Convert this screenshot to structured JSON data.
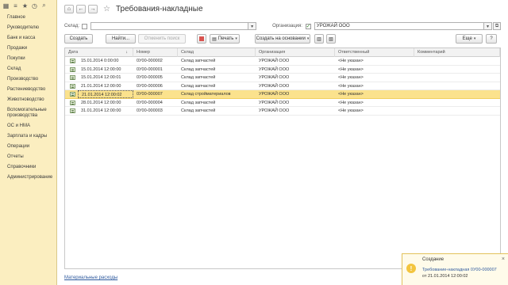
{
  "sidebar": {
    "top_icons": [
      "apps-grid-icon",
      "menu-icon",
      "star-icon",
      "history-icon",
      "search-icon"
    ],
    "items": [
      {
        "label": "Главное"
      },
      {
        "label": "Руководителю"
      },
      {
        "label": "Банк и касса"
      },
      {
        "label": "Продажи"
      },
      {
        "label": "Покупки"
      },
      {
        "label": "Склад"
      },
      {
        "label": "Производство"
      },
      {
        "label": "Растениеводство"
      },
      {
        "label": "Животноводство"
      },
      {
        "label": "Вспомогательные производства"
      },
      {
        "label": "ОС и НМА"
      },
      {
        "label": "Зарплата и кадры"
      },
      {
        "label": "Операции"
      },
      {
        "label": "Отчеты"
      },
      {
        "label": "Справочники"
      },
      {
        "label": "Администрирование"
      }
    ]
  },
  "header": {
    "title": "Требования-накладные",
    "home_glyph": "⌂",
    "back_glyph": "←",
    "forward_glyph": "→",
    "star_glyph": "☆"
  },
  "filters": {
    "warehouse_label": "Склад:",
    "warehouse_value": "",
    "organization_label": "Организация:",
    "organization_value": "УРОЖАЙ ООО",
    "dropdown_glyph": "▾",
    "open_glyph": "⧉",
    "check_glyph": "✓"
  },
  "toolbar": {
    "create": "Создать",
    "find": "Найти...",
    "cancel_search": "Отменить поиск",
    "print": "Печать",
    "create_based": "Создать на основании",
    "more": "Еще",
    "help": "?",
    "dropdown_glyph": "▾"
  },
  "table": {
    "columns": [
      "Дата",
      "Номер",
      "Склад",
      "Организация",
      "Ответственный",
      "Комментарий"
    ],
    "sort_glyph": "↓",
    "rows": [
      {
        "date": "15.01.2014 0:00:00",
        "number": "0У00-000002",
        "warehouse": "Склад запчастей",
        "org": "УРОЖАЙ ООО",
        "resp": "<Не указан>",
        "comment": ""
      },
      {
        "date": "15.01.2014 12:00:00",
        "number": "0У00-000001",
        "warehouse": "Склад запчастей",
        "org": "УРОЖАЙ ООО",
        "resp": "<Не указан>",
        "comment": ""
      },
      {
        "date": "15.01.2014 12:00:01",
        "number": "0У00-000005",
        "warehouse": "Склад запчастей",
        "org": "УРОЖАЙ ООО",
        "resp": "<Не указан>",
        "comment": ""
      },
      {
        "date": "21.01.2014 12:00:00",
        "number": "0У00-000006",
        "warehouse": "Склад запчастей",
        "org": "УРОЖАЙ ООО",
        "resp": "<Не указан>",
        "comment": ""
      },
      {
        "date": "21.01.2014 12:00:02",
        "number": "0У00-000007",
        "warehouse": "Склад стройматериалов",
        "org": "УРОЖАЙ ООО",
        "resp": "<Не указан>",
        "comment": "",
        "selected": true
      },
      {
        "date": "28.01.2014 12:00:00",
        "number": "0У00-000004",
        "warehouse": "Склад запчастей",
        "org": "УРОЖАЙ ООО",
        "resp": "<Не указан>",
        "comment": ""
      },
      {
        "date": "31.01.2014 12:00:00",
        "number": "0У00-000003",
        "warehouse": "Склад запчастей",
        "org": "УРОЖАЙ ООО",
        "resp": "<Не указан>",
        "comment": ""
      }
    ]
  },
  "footer": {
    "link": "Материальные расходы"
  },
  "notification": {
    "title": "Создание",
    "link": "Требование-накладная 0У00-000007",
    "detail": "от 21.01.2014 12:00:02",
    "icon_glyph": "!",
    "close_glyph": "×"
  },
  "colors": {
    "sidebar_bg": "#fbeec0",
    "selected_row": "#fbe28d",
    "link": "#2f5a9e",
    "notification_bg": "#fffbea"
  }
}
